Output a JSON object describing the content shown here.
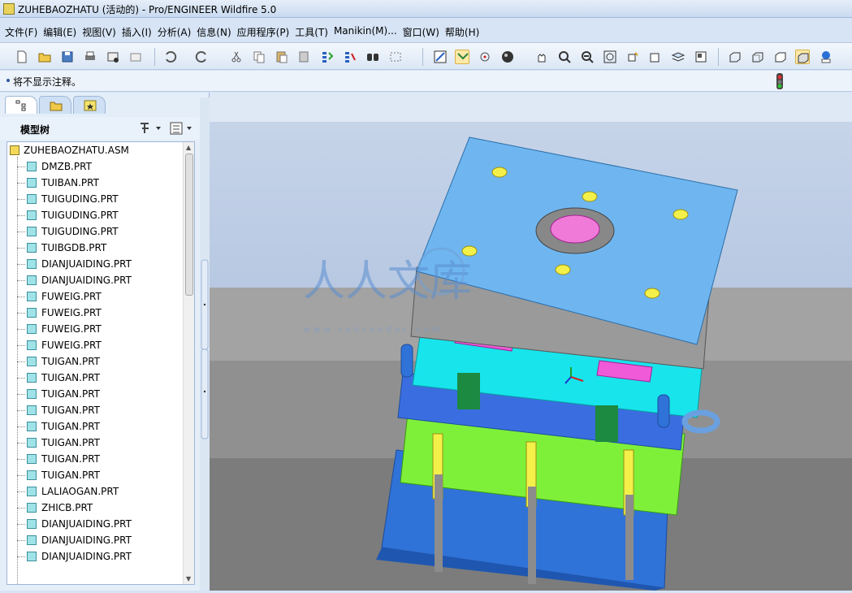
{
  "window": {
    "title": "ZUHEBAOZHATU (活动的) - Pro/ENGINEER Wildfire 5.0"
  },
  "menu": [
    "文件(F)",
    "编辑(E)",
    "视图(V)",
    "插入(I)",
    "分析(A)",
    "信息(N)",
    "应用程序(P)",
    "工具(T)",
    "Manikin(M)...",
    "窗口(W)",
    "帮助(H)"
  ],
  "message": "将不显示注释。",
  "tree": {
    "title": "模型树",
    "root": "ZUHEBAOZHATU.ASM",
    "items": [
      "DMZB.PRT",
      "TUIBAN.PRT",
      "TUIGUDING.PRT",
      "TUIGUDING.PRT",
      "TUIGUDING.PRT",
      "TUIBGDB.PRT",
      "DIANJUAIDING.PRT",
      "DIANJUAIDING.PRT",
      "FUWEIG.PRT",
      "FUWEIG.PRT",
      "FUWEIG.PRT",
      "FUWEIG.PRT",
      "TUIGAN.PRT",
      "TUIGAN.PRT",
      "TUIGAN.PRT",
      "TUIGAN.PRT",
      "TUIGAN.PRT",
      "TUIGAN.PRT",
      "TUIGAN.PRT",
      "TUIGAN.PRT",
      "LALIAOGAN.PRT",
      "ZHICB.PRT",
      "DIANJUAIDING.PRT",
      "DIANJUAIDING.PRT",
      "DIANJUAIDING.PRT"
    ]
  },
  "watermark": {
    "text": "人人文库",
    "url": "w w w . r e n r e n d o c . c o m"
  },
  "colors": {
    "plate_top": "#6fb6f0",
    "cavity": "#18e4ec",
    "support": "#3a7de0",
    "ejector_zone": "#7ef03a",
    "pin_yellow": "#f4f04a",
    "gray_plate": "#9a9a9a",
    "magenta": "#f05ad8"
  }
}
